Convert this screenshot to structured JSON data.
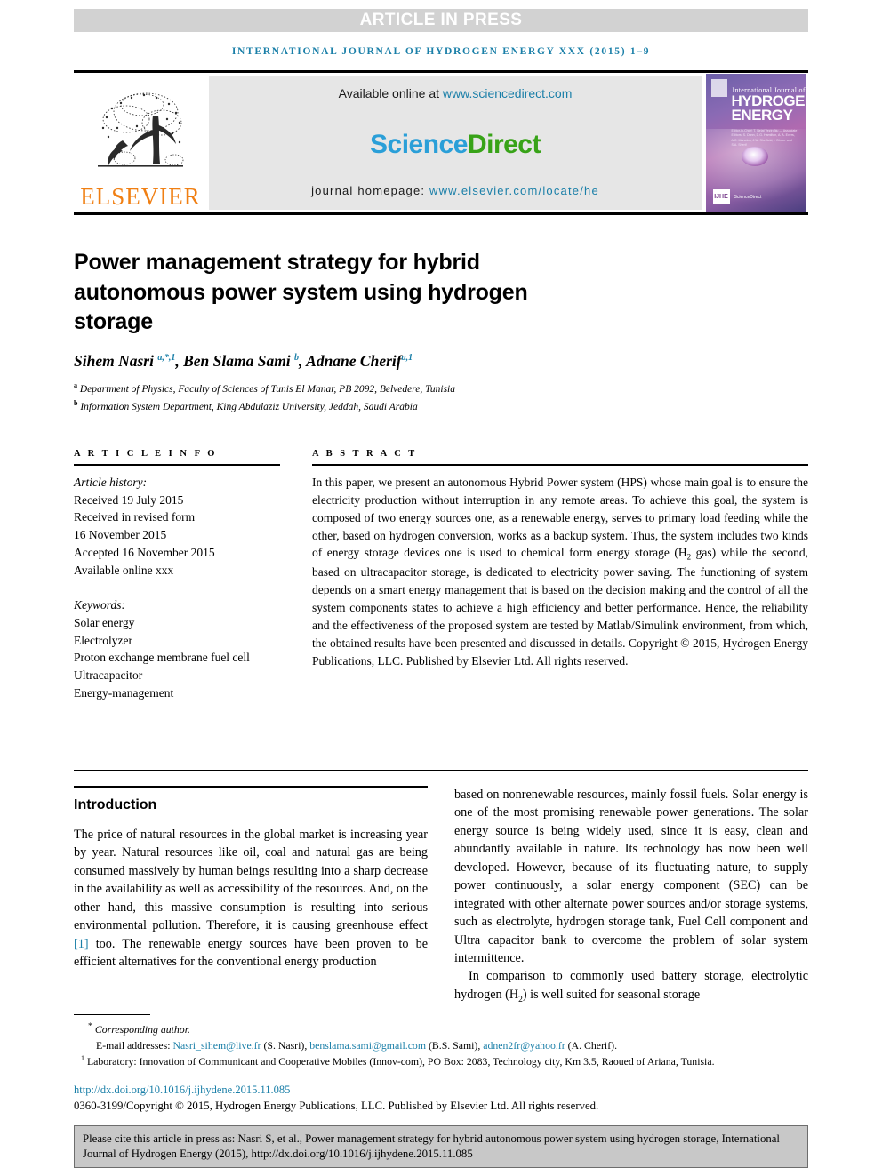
{
  "banner": {
    "text": "ARTICLE IN PRESS",
    "bg_color": "#d2d2d2",
    "text_color": "#ffffff"
  },
  "running_head": "INTERNATIONAL JOURNAL OF HYDROGEN ENERGY XXX (2015) 1–9",
  "masthead": {
    "publisher_name": "ELSEVIER",
    "publisher_color": "#f07f13",
    "available_prefix": "Available online at ",
    "available_url": "www.sciencedirect.com",
    "sciencedirect_part1": "Science",
    "sciencedirect_part2": "Direct",
    "sciencedirect_color1": "#2a9fd8",
    "sciencedirect_color2": "#38a318",
    "homepage_prefix": "journal homepage: ",
    "homepage_url": "www.elsevier.com/locate/he",
    "cover": {
      "line_small": "International Journal of",
      "line_big1": "HYDROGEN",
      "line_big2": "ENERGY",
      "editors_blob": "Editor-in-Chief:  T. Nejat Veziroğlu  —  Associate Editors:  S. Dunn, D.G. Hamilton, A. A. Evers, A.C. Marsden, J.W. Sheffield, I. Dincer and S.A. Sherif",
      "badge": "IJHE",
      "provider": "ScienceDirect"
    }
  },
  "article": {
    "title": "Power management strategy for hybrid autonomous power system using hydrogen storage",
    "authors_html": "Sihem Nasri <sup>a,*,1</sup>, Ben Slama Sami <sup>b</sup>, Adnane Cherif<sup>a,1</sup>",
    "affiliations": [
      {
        "marker": "a",
        "text": "Department of Physics, Faculty of Sciences of Tunis El Manar, PB 2092, Belvedere, Tunisia"
      },
      {
        "marker": "b",
        "text": "Information System Department, King Abdulaziz University, Jeddah, Saudi Arabia"
      }
    ]
  },
  "article_info": {
    "heading": "A R T I C L E   I N F O",
    "history_label": "Article history:",
    "history": [
      "Received 19 July 2015",
      "Received in revised form",
      "16 November 2015",
      "Accepted 16 November 2015",
      "Available online xxx"
    ],
    "keywords_label": "Keywords:",
    "keywords": [
      "Solar energy",
      "Electrolyzer",
      "Proton exchange membrane fuel cell",
      "Ultracapacitor",
      "Energy-management"
    ]
  },
  "abstract": {
    "heading": "A B S T R A C T",
    "body_html": "In this paper, we present an autonomous Hybrid Power system (HPS) whose main goal is to ensure the electricity production without interruption in any remote areas. To achieve this goal, the system is composed of two energy sources one, as a renewable energy, serves to primary load feeding while the other, based on hydrogen conversion, works as a backup system. Thus, the system includes two kinds of energy storage devices one is used to chemical form energy storage (H<sub>2</sub> gas) while the second, based on ultracapacitor storage, is dedicated to electricity power saving. The functioning of system depends on a smart energy management that is based on the decision making and the control of all the system components states to achieve a high efficiency and better performance. Hence, the reliability and the effectiveness of the proposed system are tested by Matlab/Simulink environment, from which, the obtained results have been presented and discussed in details.",
    "copyright": "Copyright © 2015, Hydrogen Energy Publications, LLC. Published by Elsevier Ltd. All rights reserved."
  },
  "introduction": {
    "heading": "Introduction",
    "left_paragraph": "The price of natural resources in the global market is increasing year by year. Natural resources like oil, coal and natural gas are being consumed massively by human beings resulting into a sharp decrease in the availability as well as accessibility of the resources. And, on the other hand, this massive consumption is resulting into serious environmental pollution. Therefore, it is causing greenhouse effect",
    "reference_marker": "[1]",
    "left_paragraph_tail": "too. The renewable energy sources have been proven to be efficient alternatives for the conventional energy production",
    "right_paragraph_1": "based on nonrenewable resources, mainly fossil fuels. Solar energy is one of the most promising renewable power generations. The solar energy source is being widely used, since it is easy, clean and abundantly available in nature. Its technology has now been well developed. However, because of its fluctuating nature, to supply power continuously, a solar energy component (SEC) can be integrated with other alternate power sources and/or storage systems, such as electrolyte, hydrogen storage tank, Fuel Cell component and Ultra capacitor bank to overcome the problem of solar system intermittence.",
    "right_paragraph_2_html": "In comparison to commonly used battery storage, electrolytic hydrogen (H<sub>2</sub>) is well suited for seasonal storage"
  },
  "footnotes": {
    "corresponding": "Corresponding author.",
    "email_label": "E-mail addresses:",
    "emails": [
      {
        "address": "Nasri_sihem@live.fr",
        "person": "(S. Nasri)"
      },
      {
        "address": "benslama.sami@gmail.com",
        "person": "(B.S. Sami)"
      },
      {
        "address": "adnen2fr@yahoo.fr",
        "person": "(A. Cherif)."
      }
    ],
    "lab_marker": "1",
    "lab_text": "Laboratory: Innovation of Communicant and Cooperative Mobiles (Innov-com), PO Box: 2083, Technology city, Km 3.5, Raoued of Ariana, Tunisia.",
    "doi": "http://dx.doi.org/10.1016/j.ijhydene.2015.11.085",
    "copyright_line": "0360-3199/Copyright © 2015, Hydrogen Energy Publications, LLC. Published by Elsevier Ltd. All rights reserved."
  },
  "cite_box": {
    "text": "Please cite this article in press as: Nasri S, et al., Power management strategy for hybrid autonomous power system using hydrogen storage, International Journal of Hydrogen Energy (2015), http://dx.doi.org/10.1016/j.ijhydene.2015.11.085"
  },
  "colors": {
    "link": "#1a7fa8",
    "banner_bg": "#d2d2d2",
    "masthead_panel": "#e6e6e6",
    "cite_bg": "#c8c8c8"
  }
}
